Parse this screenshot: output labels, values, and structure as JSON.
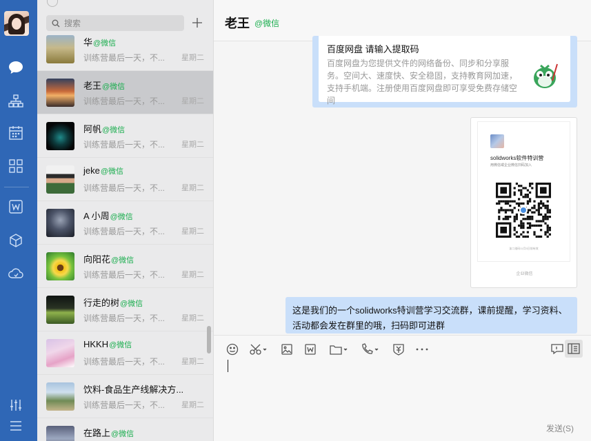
{
  "search": {
    "placeholder": "搜索"
  },
  "chats": [
    {
      "name": "华",
      "tag": "@微信",
      "preview": "训练营最后一天，不...",
      "time": "星期二",
      "thumb": "landscape-field"
    },
    {
      "name": "老王",
      "tag": "@微信",
      "preview": "训练营最后一天，不...",
      "time": "星期二",
      "thumb": "sunset-sky",
      "active": true
    },
    {
      "name": "阿帆",
      "tag": "@微信",
      "preview": "训练营最后一天，不...",
      "time": "星期二",
      "thumb": "dark-graphic"
    },
    {
      "name": "jeke",
      "tag": "@微信",
      "preview": "训练营最后一天，不...",
      "time": "星期二",
      "thumb": "person-photo"
    },
    {
      "name": "A 小周",
      "tag": "@微信",
      "preview": "训练营最后一天，不...",
      "time": "星期二",
      "thumb": "robot-cartoon"
    },
    {
      "name": "向阳花",
      "tag": "@微信",
      "preview": "训练营最后一天，不...",
      "time": "星期二",
      "thumb": "sunflower"
    },
    {
      "name": "行走的树",
      "tag": "@微信",
      "preview": "训练营最后一天，不...",
      "time": "星期二",
      "thumb": "night-field"
    },
    {
      "name": "HKKH",
      "tag": "@微信",
      "preview": "训练营最后一天，不...",
      "time": "星期二",
      "thumb": "pink-sky"
    },
    {
      "name": "饮料-食品生产线解决方...",
      "tag": "",
      "preview": "训练营最后一天，不...",
      "time": "星期二",
      "thumb": "tree-photo"
    },
    {
      "name": "在路上",
      "tag": "@微信",
      "preview": "",
      "time": "",
      "thumb": "road-sky"
    }
  ],
  "conversation": {
    "title": "老王",
    "tag": "@微信",
    "link_card": {
      "title": "百度网盘 请输入提取码",
      "description": "百度网盘为您提供文件的网络备份、同步和分享服务。空间大、速度快、安全稳固，支持教育网加速，支持手机端。注册使用百度网盘即可享受免费存储空间"
    },
    "poster": {
      "title": "solidworks软件特训营",
      "subtitle": "用微信或企业微信扫码加入",
      "footer": "该二维码11月5日前有效",
      "brand": "企业微信"
    },
    "text_message": "这是我们的一个solidworks特训营学习交流群，课前提醒，学习资料、活动都会发在群里的哦，扫码即可进群"
  },
  "input": {
    "send_label": "发送(S)"
  },
  "colors": {
    "nav": "#2f67b6",
    "bubble": "#c9dffa",
    "wechat_tag": "#1aad4e"
  }
}
